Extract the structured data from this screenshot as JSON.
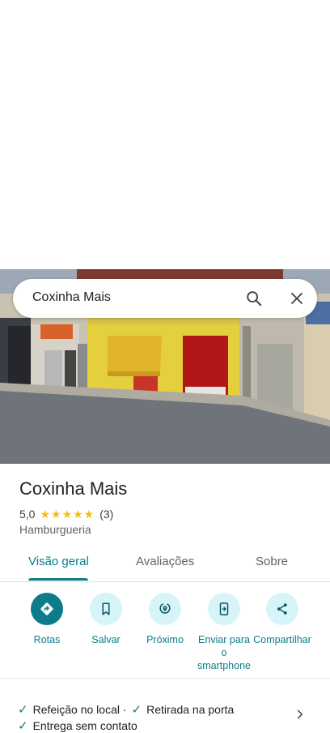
{
  "search": {
    "query": "Coxinha Mais"
  },
  "place": {
    "name": "Coxinha Mais",
    "rating": "5,0",
    "stars": "★★★★★",
    "review_count": "(3)",
    "category": "Hamburgueria"
  },
  "tabs": [
    {
      "label": "Visão geral",
      "active": true
    },
    {
      "label": "Avaliações",
      "active": false
    },
    {
      "label": "Sobre",
      "active": false
    }
  ],
  "actions": [
    {
      "label": "Rotas",
      "icon": "directions-icon"
    },
    {
      "label": "Salvar",
      "icon": "bookmark-icon"
    },
    {
      "label": "Próximo",
      "icon": "nearby-icon"
    },
    {
      "label": "Enviar para o smartphone",
      "icon": "send-to-phone-icon"
    },
    {
      "label": "Compartilhar",
      "icon": "share-icon"
    }
  ],
  "services": {
    "line1_a": "Refeição no local ·",
    "line1_b": "Retirada na porta",
    "line2": "Entrega sem contato"
  },
  "colors": {
    "accent": "#0b7d8a",
    "accent_light": "#d7f4f8",
    "star": "#fbbc04",
    "check": "#188038"
  }
}
